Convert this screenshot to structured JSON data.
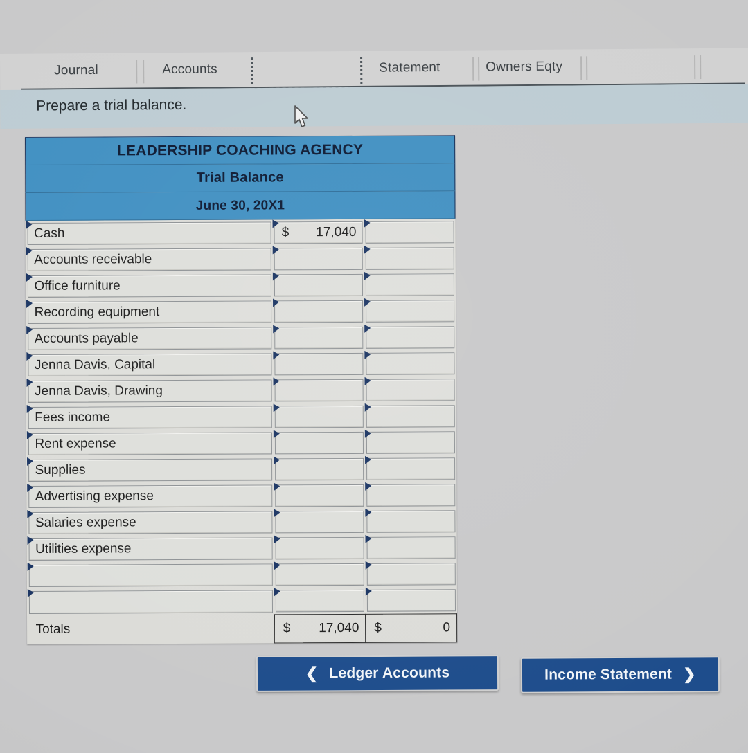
{
  "tabs": [
    {
      "label": "Journal"
    },
    {
      "label": "Accounts"
    },
    {
      "label": "Statement"
    },
    {
      "label": "Owners Eqty"
    }
  ],
  "instruction": {
    "text": "Prepare a trial balance."
  },
  "trial_balance": {
    "company": "LEADERSHIP COACHING AGENCY",
    "statement_title": "Trial Balance",
    "date": "June 30, 20X1",
    "rows": [
      {
        "account": "Cash",
        "debit_currency": "$",
        "debit": "17,040",
        "credit_currency": "",
        "credit": ""
      },
      {
        "account": "Accounts receivable",
        "debit_currency": "",
        "debit": "",
        "credit_currency": "",
        "credit": ""
      },
      {
        "account": "Office furniture",
        "debit_currency": "",
        "debit": "",
        "credit_currency": "",
        "credit": ""
      },
      {
        "account": "Recording equipment",
        "debit_currency": "",
        "debit": "",
        "credit_currency": "",
        "credit": ""
      },
      {
        "account": "Accounts payable",
        "debit_currency": "",
        "debit": "",
        "credit_currency": "",
        "credit": ""
      },
      {
        "account": "Jenna Davis, Capital",
        "debit_currency": "",
        "debit": "",
        "credit_currency": "",
        "credit": ""
      },
      {
        "account": "Jenna Davis, Drawing",
        "debit_currency": "",
        "debit": "",
        "credit_currency": "",
        "credit": ""
      },
      {
        "account": "Fees income",
        "debit_currency": "",
        "debit": "",
        "credit_currency": "",
        "credit": ""
      },
      {
        "account": "Rent expense",
        "debit_currency": "",
        "debit": "",
        "credit_currency": "",
        "credit": ""
      },
      {
        "account": "Supplies",
        "debit_currency": "",
        "debit": "",
        "credit_currency": "",
        "credit": ""
      },
      {
        "account": "Advertising expense",
        "debit_currency": "",
        "debit": "",
        "credit_currency": "",
        "credit": ""
      },
      {
        "account": "Salaries expense",
        "debit_currency": "",
        "debit": "",
        "credit_currency": "",
        "credit": ""
      },
      {
        "account": "Utilities expense",
        "debit_currency": "",
        "debit": "",
        "credit_currency": "",
        "credit": ""
      },
      {
        "account": "",
        "debit_currency": "",
        "debit": "",
        "credit_currency": "",
        "credit": ""
      },
      {
        "account": "",
        "debit_currency": "",
        "debit": "",
        "credit_currency": "",
        "credit": ""
      }
    ],
    "totals": {
      "label": "Totals",
      "debit_currency": "$",
      "debit": "17,040",
      "credit_currency": "$",
      "credit": "0"
    }
  },
  "nav": {
    "prev_label": "Ledger Accounts",
    "prev_icon": "chevron-left-icon",
    "next_label": "Income Statement",
    "next_icon": "chevron-right-icon"
  },
  "colors": {
    "header_blue": "#4190c2",
    "button_blue": "#1e4d8c",
    "instruction_band": "#bdccd3",
    "page_background": "#c9c9ca",
    "grid_border": "#17315b"
  }
}
